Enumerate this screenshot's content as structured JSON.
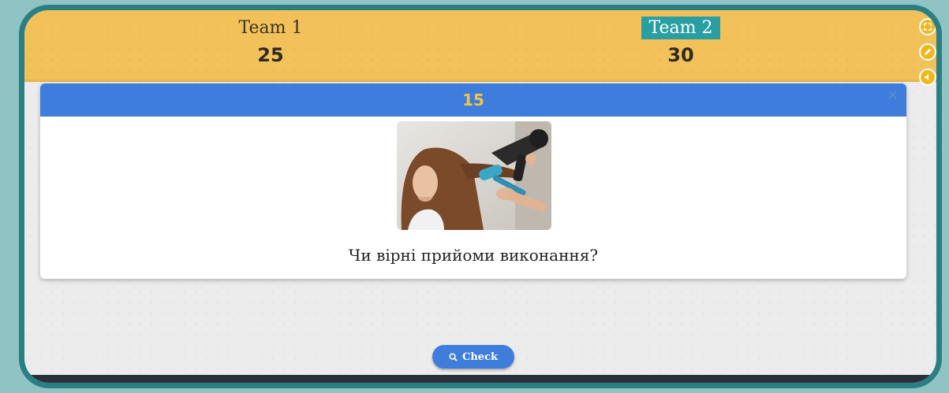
{
  "teams": [
    {
      "name": "Team 1",
      "score": "25",
      "active": false
    },
    {
      "name": "Team 2",
      "score": "30",
      "active": true
    }
  ],
  "side_buttons": [
    "fullscreen-icon",
    "pencil-icon",
    "sound-icon"
  ],
  "modal": {
    "timer": "15",
    "close_label": "×",
    "question": "Чи вірні прийоми виконання?"
  },
  "check_button": {
    "label": "Check",
    "icon": "search-icon"
  },
  "colors": {
    "scorebar": "#f2c15a",
    "frame": "#2a7f82",
    "header_blue": "#3e7ddb",
    "timer": "#f5c442",
    "active_team": "#2a9fa3"
  }
}
